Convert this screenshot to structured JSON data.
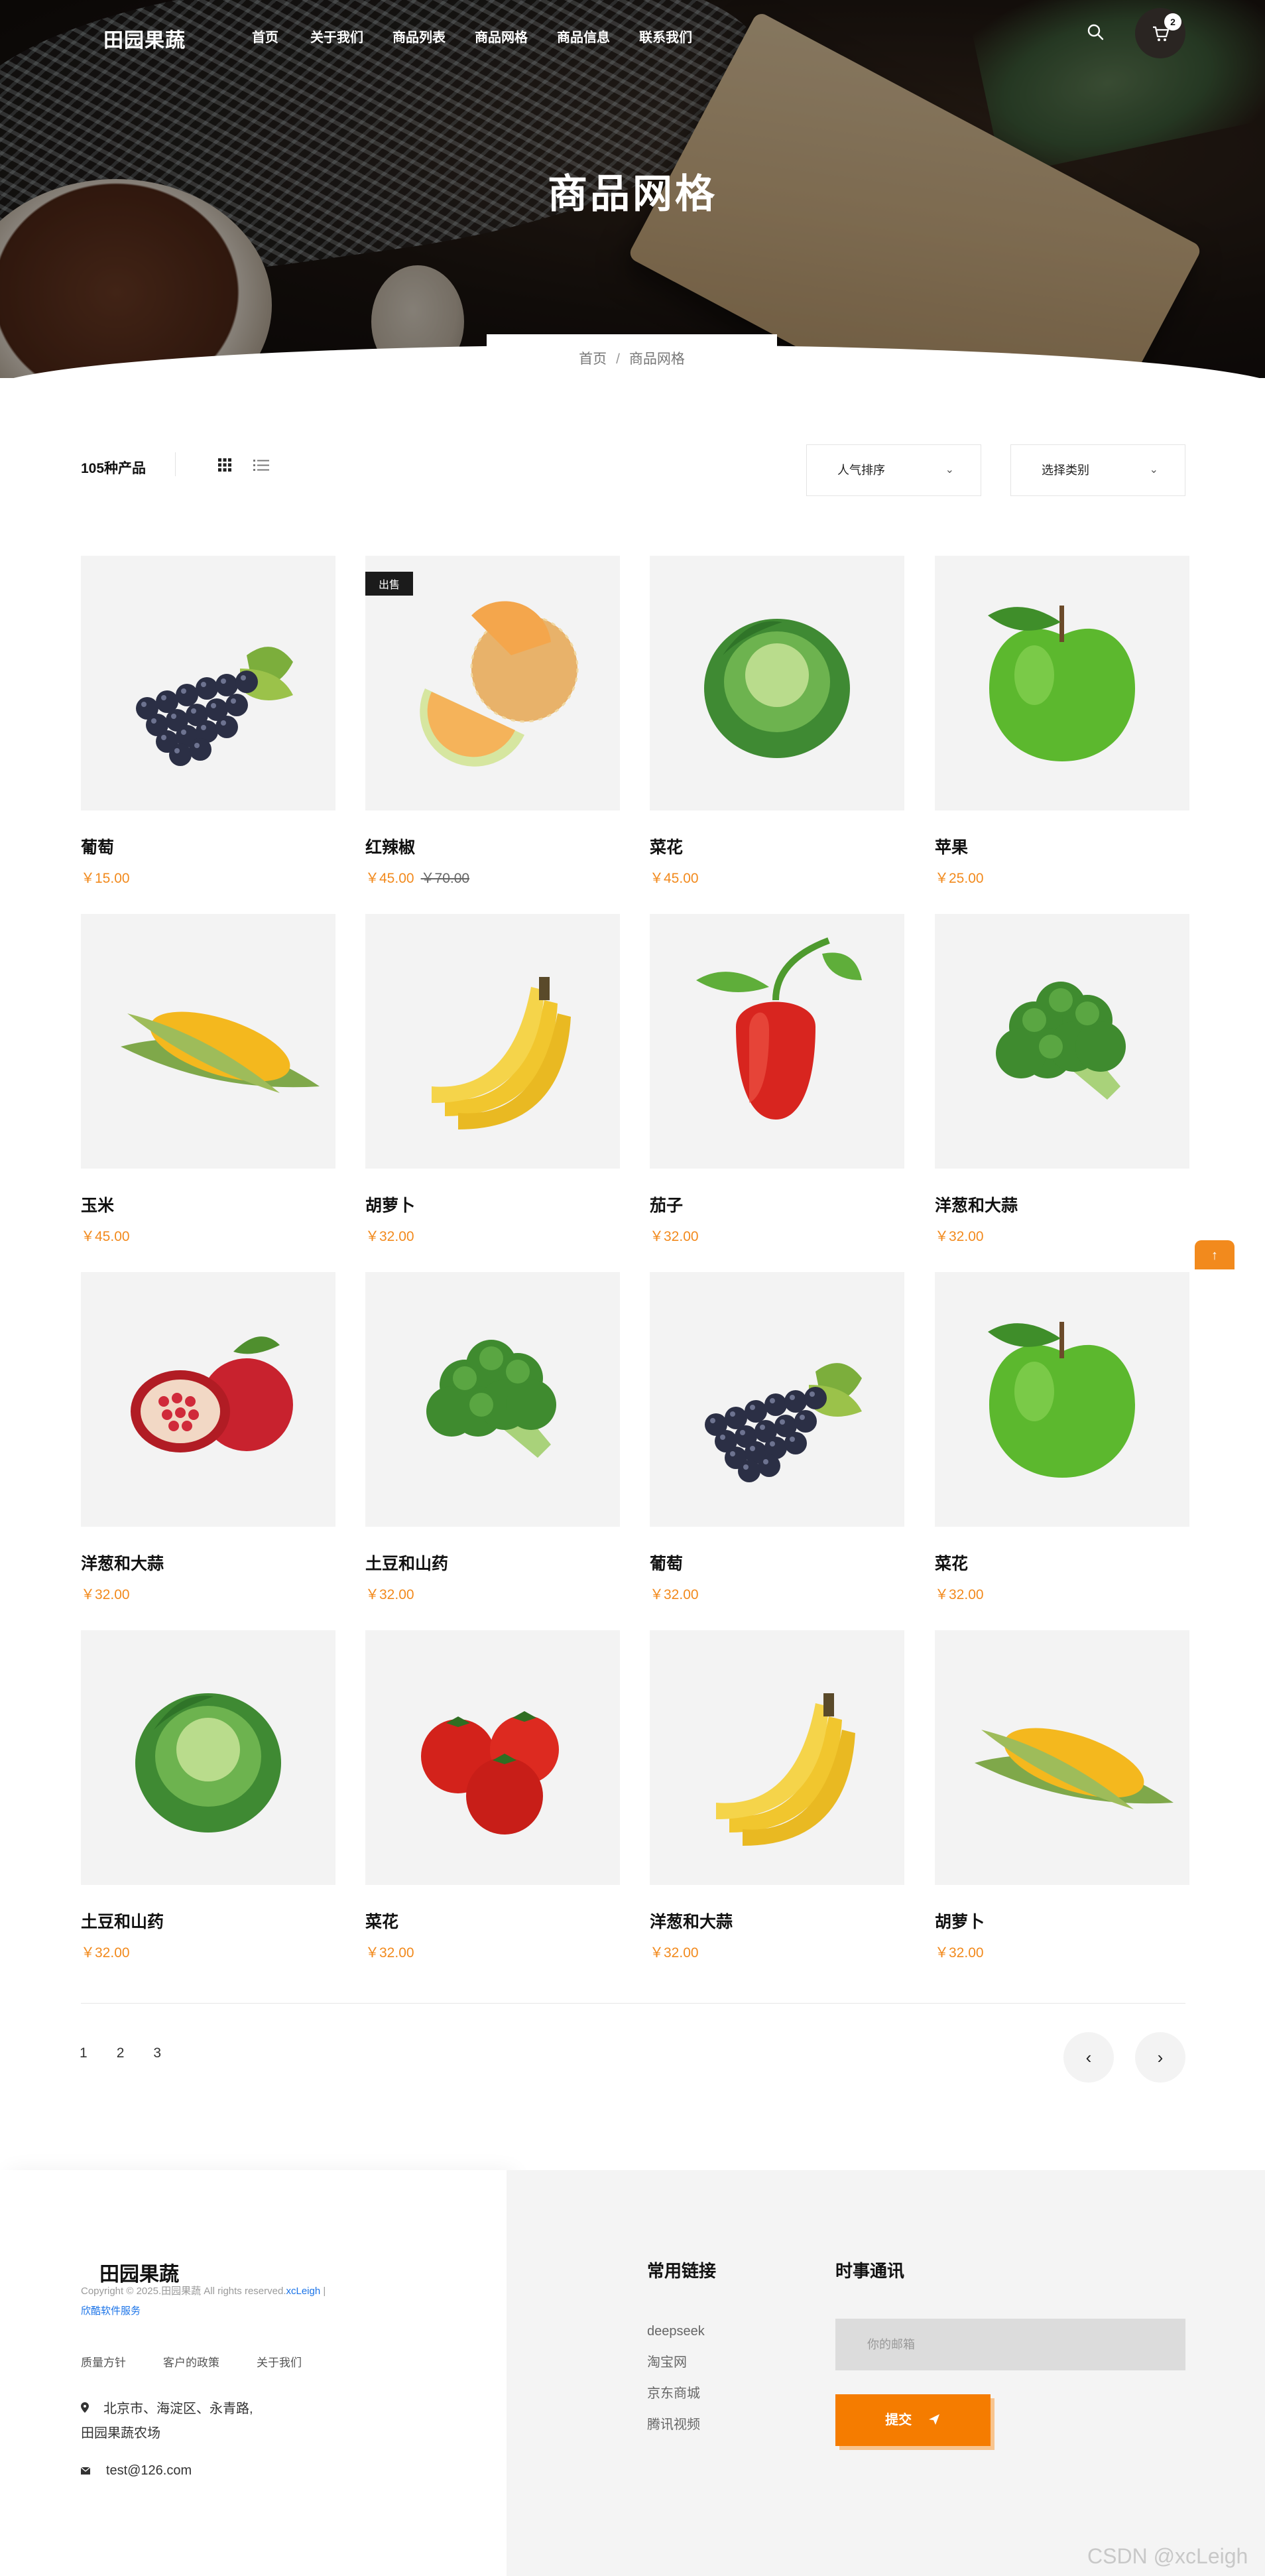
{
  "header": {
    "brand": "田园果蔬",
    "nav": [
      "首页",
      "关于我们",
      "商品列表",
      "商品网格",
      "商品信息",
      "联系我们"
    ],
    "cart_count": "2"
  },
  "hero": {
    "title": "商品网格",
    "breadcrumb": [
      "首页",
      "/",
      "商品网格"
    ]
  },
  "toolbar": {
    "count": "105种产品",
    "sort_select": "人气排序",
    "category_select": "选择类别",
    "chevron": "⌄"
  },
  "products": [
    {
      "name": "葡萄",
      "price": "￥15.00",
      "icon": "grapes"
    },
    {
      "name": "红辣椒",
      "price": "￥45.00",
      "old_price": "￥70.00",
      "badge": "出售",
      "icon": "melon"
    },
    {
      "name": "菜花",
      "price": "￥45.00",
      "icon": "cabbage"
    },
    {
      "name": "苹果",
      "price": "￥25.00",
      "icon": "apple"
    },
    {
      "name": "玉米",
      "price": "￥45.00",
      "icon": "corn"
    },
    {
      "name": "胡萝卜",
      "price": "￥32.00",
      "icon": "banana"
    },
    {
      "name": "茄子",
      "price": "￥32.00",
      "icon": "pepper"
    },
    {
      "name": "洋葱和大蒜",
      "price": "￥32.00",
      "icon": "broccoli"
    },
    {
      "name": "洋葱和大蒜",
      "price": "￥32.00",
      "icon": "pomegranate"
    },
    {
      "name": "土豆和山药",
      "price": "￥32.00",
      "icon": "broccoli"
    },
    {
      "name": "葡萄",
      "price": "￥32.00",
      "icon": "grapes"
    },
    {
      "name": "菜花",
      "price": "￥32.00",
      "icon": "apple"
    },
    {
      "name": "土豆和山药",
      "price": "￥32.00",
      "icon": "cabbage"
    },
    {
      "name": "菜花",
      "price": "￥32.00",
      "icon": "tomato"
    },
    {
      "name": "洋葱和大蒜",
      "price": "￥32.00",
      "icon": "banana"
    },
    {
      "name": "胡萝卜",
      "price": "￥32.00",
      "icon": "corn"
    }
  ],
  "pagination": {
    "pages": [
      "1",
      "2",
      "3"
    ],
    "prev": "‹",
    "next": "›",
    "to_top": "↑"
  },
  "footer": {
    "brand": "田园果蔬",
    "copyright": "Copyright © 2025.田园果蔬 All rights reserved.",
    "copyright_link": "xcLeigh",
    "copyright_sep": " |",
    "service_link": "欣酷软件服务",
    "links": [
      "质量方针",
      "客户的政策",
      "关于我们"
    ],
    "address_line1": "北京市、海淀区、永青路,",
    "address_line2": "田园果蔬农场",
    "email": "test@126.com",
    "useful_links_title": "常用链接",
    "useful_links": [
      "deepseek",
      "淘宝网",
      "京东商城",
      "腾讯视频"
    ],
    "newsletter_title": "时事通讯",
    "email_placeholder": "你的邮箱",
    "submit_label": "提交"
  },
  "watermark": "CSDN @xcLeigh",
  "colors": {
    "accent": "#f57c00",
    "price": "#f28a1d",
    "dark": "#1b1b1b"
  }
}
